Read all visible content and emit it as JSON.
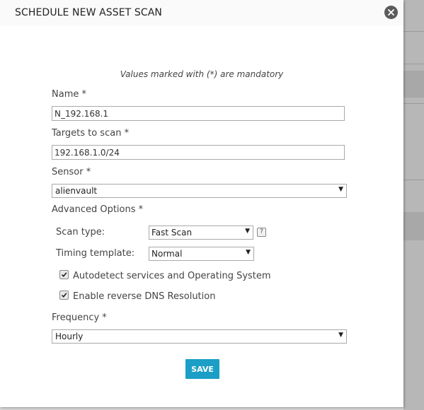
{
  "dialog": {
    "title": "SCHEDULE NEW ASSET SCAN",
    "mandatory_note": "Values marked with (*) are mandatory"
  },
  "form": {
    "name": {
      "label": "Name *",
      "value": "N_192.168.1"
    },
    "targets": {
      "label": "Targets to scan *",
      "value": "192.168.1.0/24"
    },
    "sensor": {
      "label": "Sensor *",
      "selected": "alienvault"
    },
    "advanced": {
      "label": "Advanced Options *",
      "scan_type": {
        "label": "Scan type:",
        "selected": "Fast Scan",
        "help_glyph": "?"
      },
      "timing_template": {
        "label": "Timing template:",
        "selected": "Normal"
      },
      "autodetect": {
        "label": "Autodetect services and Operating System",
        "checked": true
      },
      "reverse_dns": {
        "label": "Enable reverse DNS Resolution",
        "checked": true
      }
    },
    "frequency": {
      "label": "Frequency *",
      "selected": "Hourly"
    },
    "save_label": "SAVE"
  },
  "icons": {
    "close": "close-icon",
    "dropdown": "chevron-down-icon",
    "help": "help-icon",
    "check": "checkmark-icon"
  },
  "colors": {
    "accent": "#1b9fc6",
    "close_button": "#5b5b5b"
  }
}
